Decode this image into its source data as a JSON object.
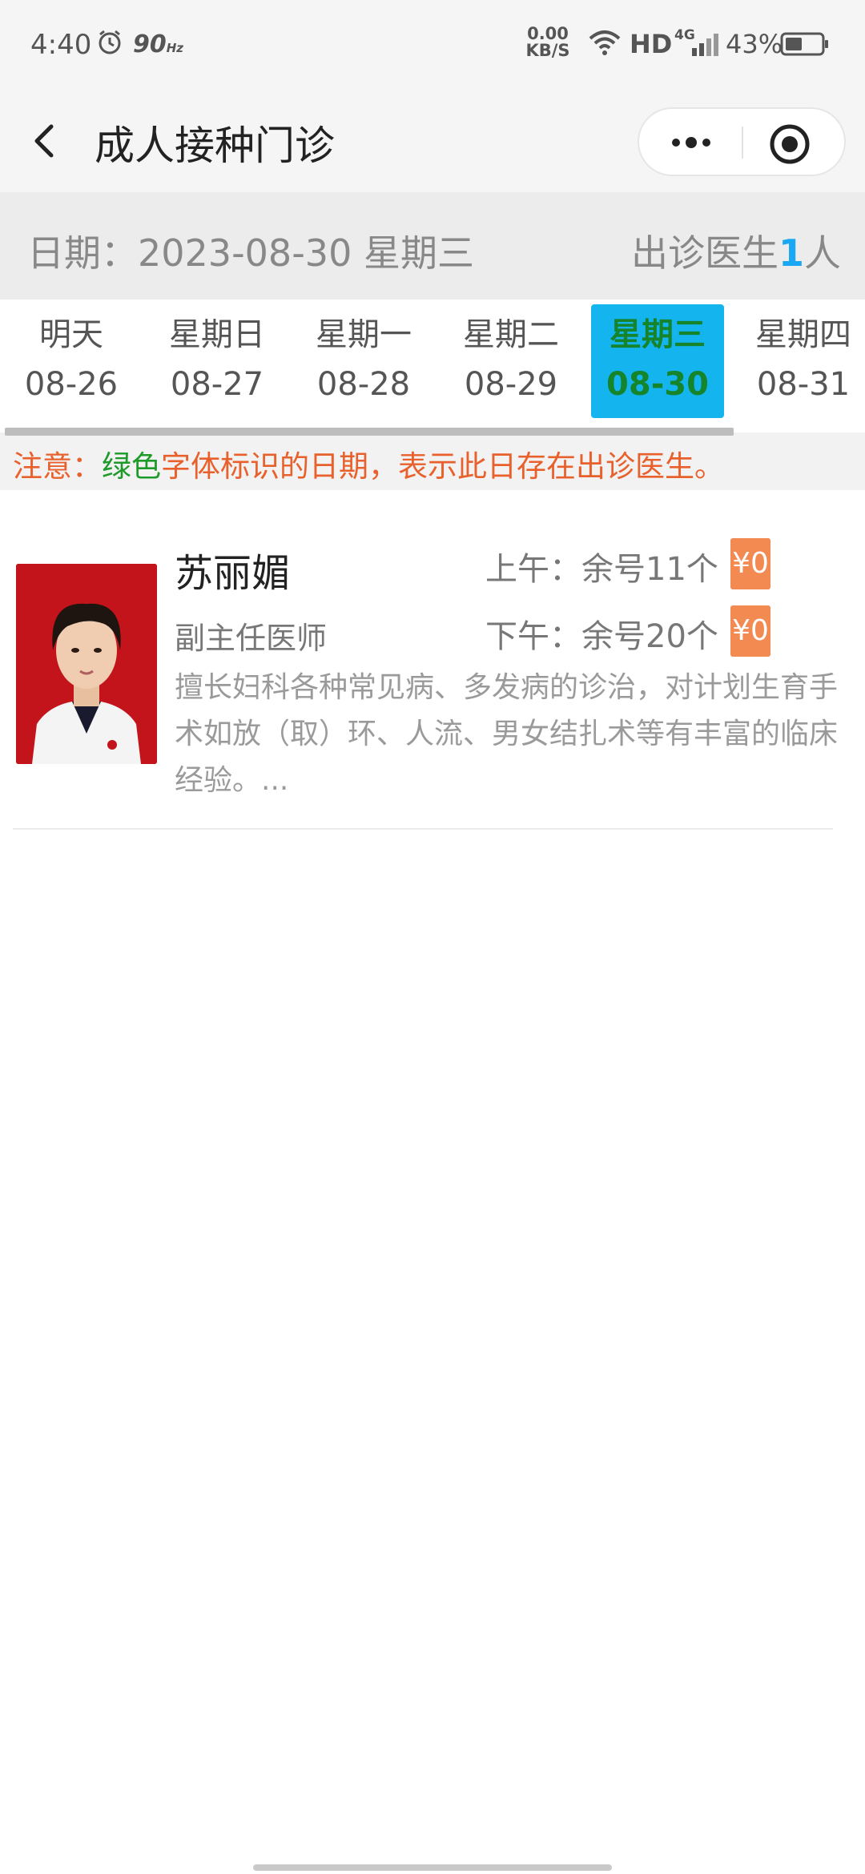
{
  "status_bar": {
    "time": "4:40",
    "refresh": "90",
    "refresh_unit": "Hz",
    "speed_value": "0.00",
    "speed_unit": "KB/S",
    "hd": "HD",
    "network": "4G",
    "battery": "43%"
  },
  "nav": {
    "title": "成人接种门诊"
  },
  "date_header": {
    "label": "日期：2023-08-30 星期三",
    "doctor_prefix": "出诊医生",
    "doctor_count": "1",
    "doctor_suffix": "人"
  },
  "day_tabs": [
    {
      "weekday": "明天",
      "date": "08-26",
      "active": false
    },
    {
      "weekday": "星期日",
      "date": "08-27",
      "active": false
    },
    {
      "weekday": "星期一",
      "date": "08-28",
      "active": false
    },
    {
      "weekday": "星期二",
      "date": "08-29",
      "active": false
    },
    {
      "weekday": "星期三",
      "date": "08-30",
      "active": true
    },
    {
      "weekday": "星期四",
      "date": "08-31",
      "active": false
    }
  ],
  "notice": {
    "prefix": "注意：",
    "highlight": "绿色",
    "suffix": "字体标识的日期，表示此日存在出诊医生。"
  },
  "doctor": {
    "name": "苏丽媚",
    "title": "副主任医师",
    "am_slot": "上午：余号11个",
    "pm_slot": "下午：余号20个",
    "am_price": "¥0",
    "pm_price": "¥0",
    "description": "擅长妇科各种常见病、多发病的诊治，对计划生育手术如放（取）环、人流、男女结扎术等有丰富的临床经验。..."
  },
  "colors": {
    "accent_blue": "#14b4ef",
    "active_green": "#15842a",
    "notice_orange": "#e8612c",
    "price_orange": "#f28a52"
  }
}
